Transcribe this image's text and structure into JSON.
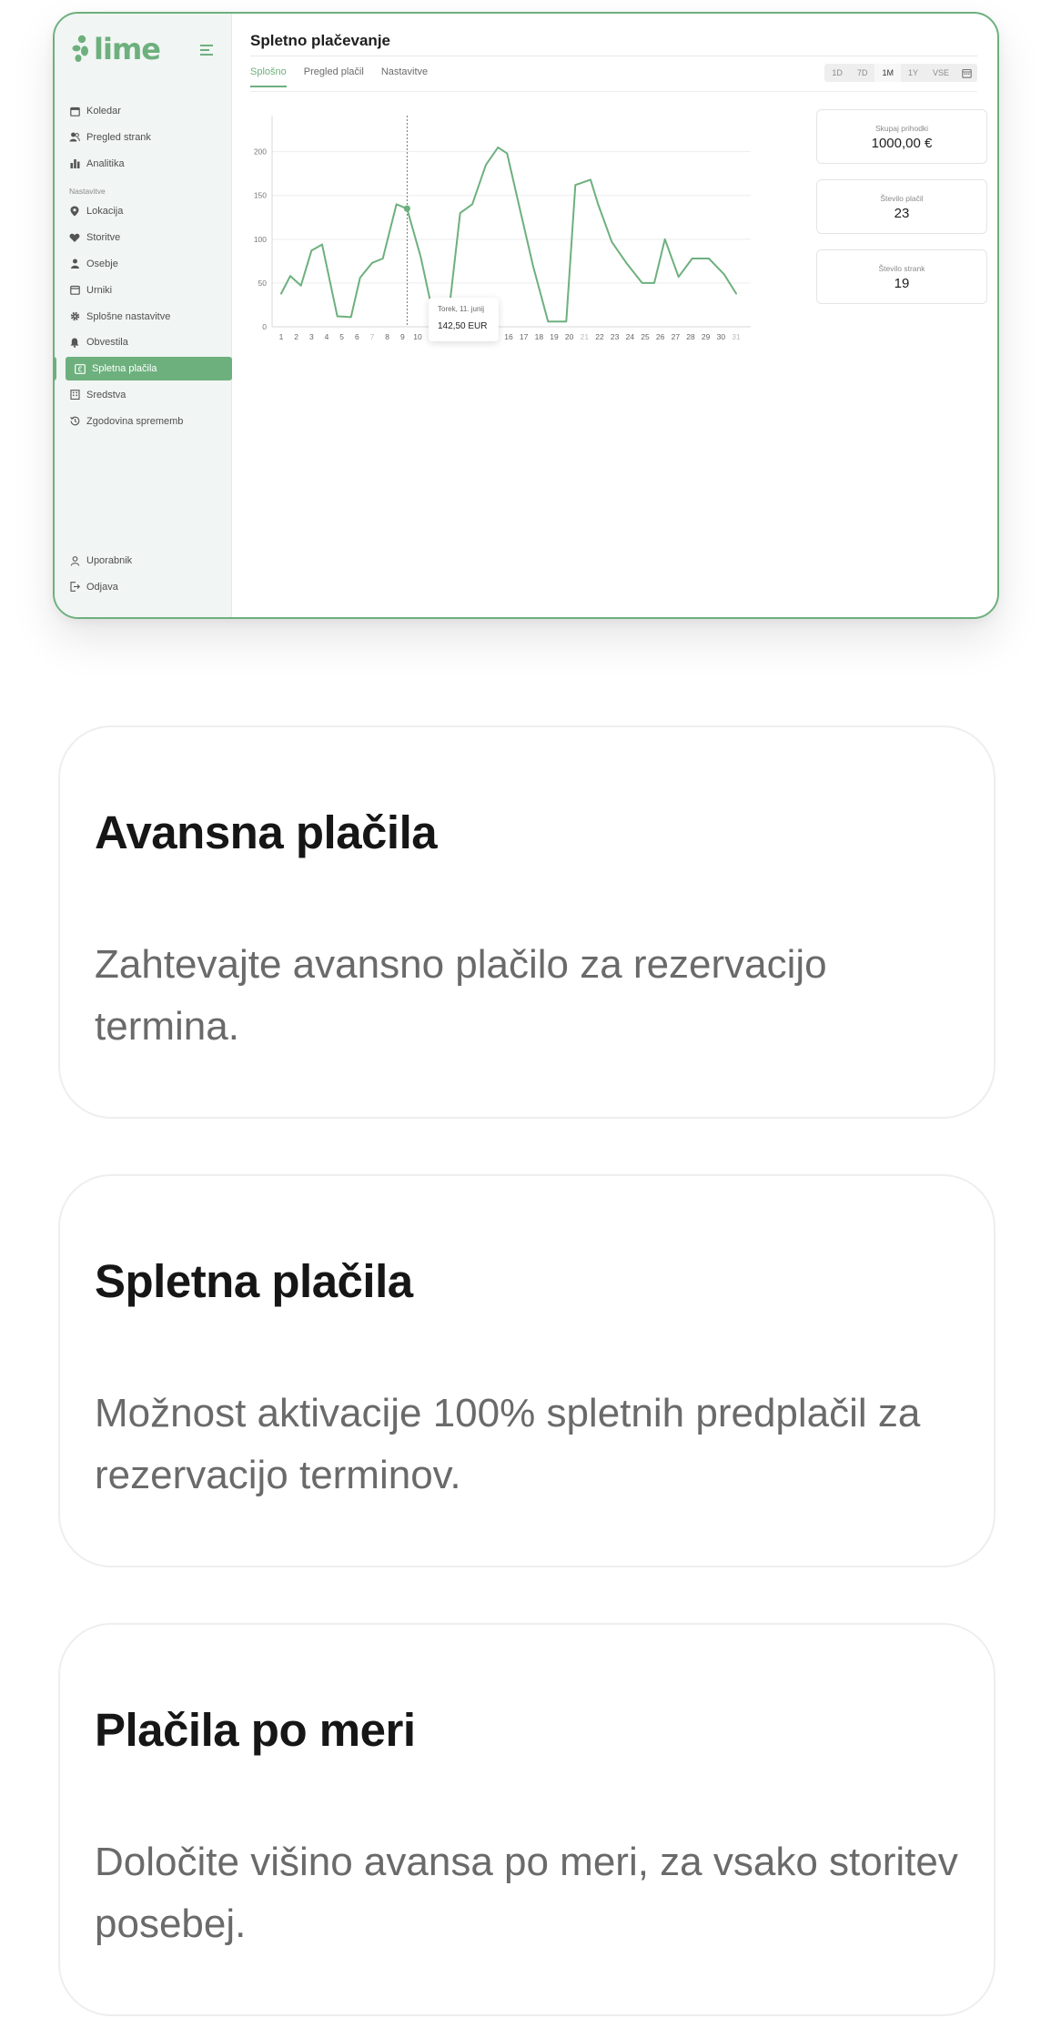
{
  "app": {
    "logo": "lime",
    "sidebar": {
      "items_top": [
        {
          "label": "Koledar",
          "icon": "calendar-icon"
        },
        {
          "label": "Pregled strank",
          "icon": "users-icon"
        },
        {
          "label": "Analitika",
          "icon": "bar-chart-icon"
        }
      ],
      "section_label": "Nastavitve",
      "items_settings": [
        {
          "label": "Lokacija",
          "icon": "location-pin-icon"
        },
        {
          "label": "Storitve",
          "icon": "heart-hand-icon"
        },
        {
          "label": "Osebje",
          "icon": "staff-icon"
        },
        {
          "label": "Urniki",
          "icon": "schedule-icon"
        },
        {
          "label": "Splošne nastavitve",
          "icon": "gear-icon"
        },
        {
          "label": "Obvestila",
          "icon": "bell-icon"
        },
        {
          "label": "Spletna plačila",
          "icon": "payment-icon",
          "active": true
        },
        {
          "label": "Sredstva",
          "icon": "building-icon"
        },
        {
          "label": "Zgodovina sprememb",
          "icon": "history-icon"
        }
      ],
      "items_bottom": [
        {
          "label": "Uporabnik",
          "icon": "user-icon"
        },
        {
          "label": "Odjava",
          "icon": "logout-icon"
        }
      ]
    },
    "page_title": "Spletno plačevanje",
    "tabs": [
      "Splošno",
      "Pregled plačil",
      "Nastavitve"
    ],
    "active_tab": "Splošno",
    "range_options": [
      "1D",
      "7D",
      "1M",
      "1Y",
      "VSE"
    ],
    "range_selected": "1M",
    "tooltip": {
      "date": "Torek, 11. junij",
      "value": "142,50 EUR"
    },
    "stats": [
      {
        "label": "Skupaj prihodki",
        "value": "1000,00 €"
      },
      {
        "label": "Število plačil",
        "value": "23"
      },
      {
        "label": "Število strank",
        "value": "19"
      }
    ],
    "accent_color": "#6db07e"
  },
  "chart_data": {
    "type": "line",
    "x": [
      "1",
      "2",
      "3",
      "4",
      "5",
      "6",
      "7",
      "8",
      "9",
      "10",
      "11",
      "12",
      "13",
      "14",
      "15",
      "16",
      "17",
      "18",
      "19",
      "20",
      "21",
      "22",
      "23",
      "24",
      "25",
      "26",
      "27",
      "28",
      "29",
      "30",
      "31"
    ],
    "muted_ticks": [
      "7",
      "14",
      "21",
      "31"
    ],
    "y_ticks": [
      0,
      50,
      100,
      150,
      200
    ],
    "ylim": [
      0,
      235
    ],
    "series": [
      {
        "x": [
          1,
          1.6,
          2.3,
          3,
          3.7,
          4.7,
          5.6,
          6.2,
          7,
          7.7,
          8.6,
          9.3,
          10.2,
          11.1,
          12,
          12.8,
          13.6,
          14.5,
          15.3,
          15.9,
          16.6,
          17.6,
          18.6,
          19.8,
          20.4,
          21.4,
          21.9,
          22.8,
          23.8,
          24.8,
          25.6,
          26.3,
          27.2,
          28.1,
          29.2,
          30.2,
          31
        ],
        "y": [
          38,
          58,
          47,
          87,
          94,
          12,
          11,
          56,
          73,
          78,
          140,
          135,
          80,
          8,
          8,
          130,
          140,
          185,
          205,
          198,
          145,
          70,
          6,
          6,
          162,
          168,
          140,
          97,
          72,
          50,
          50,
          100,
          57,
          78,
          78,
          60,
          38
        ]
      }
    ],
    "highlight_x": 9.3,
    "highlight_y": 135,
    "grid": true
  },
  "features": [
    {
      "title": "Avansna plačila",
      "text": "Zahtevajte avansno plačilo za rezervacijo termina."
    },
    {
      "title": "Spletna plačila",
      "text": "Možnost aktivacije 100% spletnih predplačil za rezervacijo terminov."
    },
    {
      "title": "Plačila po meri",
      "text": "Določite višino avansa po meri, za vsako storitev posebej."
    }
  ]
}
